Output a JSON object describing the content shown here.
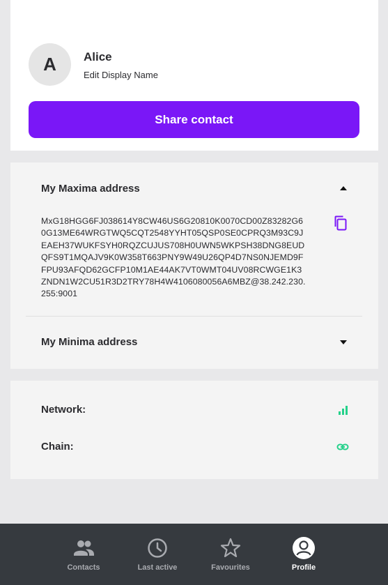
{
  "profile": {
    "avatar_initial": "A",
    "name": "Alice",
    "edit_label": "Edit Display Name",
    "share_button_label": "Share contact"
  },
  "maxima": {
    "header": "My Maxima address",
    "address": "MxG18HGG6FJ038614Y8CW46US6G20810K0070CD00Z83282G60G13ME64WRGTWQ5CQT2548YYHT05QSP0SE0CPRQ3M93C9JEAEH37WUKFSYH0RQZCUJUS708H0UWN5WKPSH38DNG8EUDQFS9T1MQAJV9K0W358T663PNY9W49U26QP4D7NS0NJEMD9FFPU93AFQD62GCFP10M1AE44AK7VT0WMT04UV08RCWGE1K3ZNDN1W2CU51R3D2TRY78H4W4106080056A6MBZ@38.242.230.255:9001",
    "expanded": true
  },
  "minima": {
    "header": "My Minima address",
    "expanded": false
  },
  "status": {
    "network_label": "Network:",
    "chain_label": "Chain:",
    "network_icon": "signal-icon",
    "chain_icon": "link-icon",
    "ok_color": "#24d18a"
  },
  "nav": {
    "items": [
      {
        "label": "Contacts",
        "icon": "contacts-icon",
        "active": false
      },
      {
        "label": "Last active",
        "icon": "clock-icon",
        "active": false
      },
      {
        "label": "Favourites",
        "icon": "star-icon",
        "active": false
      },
      {
        "label": "Profile",
        "icon": "profile-icon",
        "active": true
      }
    ]
  },
  "colors": {
    "accent": "#7a17f7",
    "nav_bg": "#363a3f",
    "nav_inactive": "#a9abb0",
    "nav_active": "#ffffff"
  }
}
